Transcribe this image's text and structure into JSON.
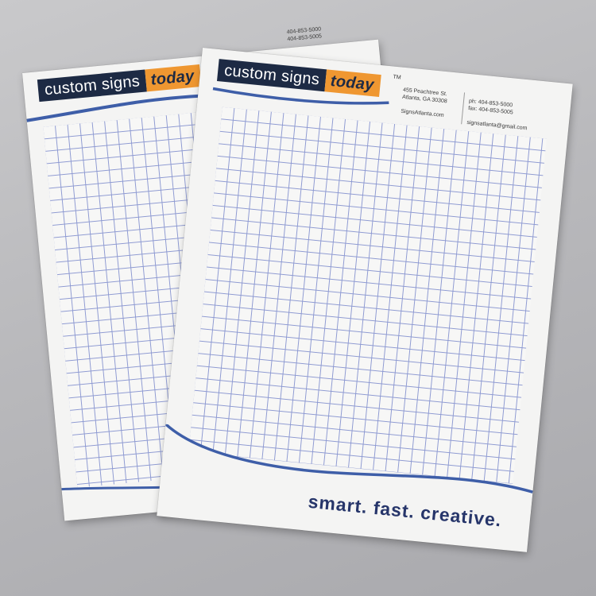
{
  "brand": {
    "word_main": "custom signs",
    "word_accent": "today",
    "trademark": "TM",
    "colors": {
      "navy": "#1d2a44",
      "orange": "#ef9731",
      "grid_blue": "#8e9ad2",
      "wave_blue": "#3e5ea8"
    }
  },
  "contact": {
    "address_line1": "455 Peachtree St.",
    "address_line2": "Atlanta, GA 30308",
    "website": "SignsAtlanta.com",
    "phone": "ph:  404-853-5000",
    "fax": "fax:  404-853-5005",
    "email": "signsatlanta@gmail.com"
  },
  "back_pad": {
    "phone_partial": "404-853-5000",
    "fax_partial": "404-853-5005"
  },
  "slogan": "smart. fast. creative."
}
